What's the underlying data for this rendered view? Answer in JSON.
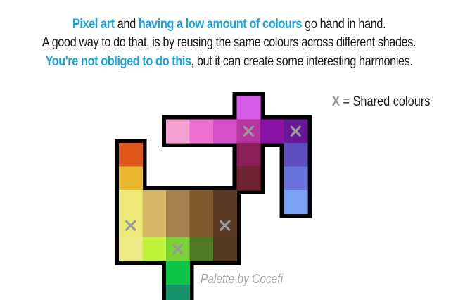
{
  "colors": {
    "accent": "#1aa3e0",
    "text": "#1a1a1a",
    "marker": "#9a9a9a",
    "credit": "#a8a8a8",
    "outline": "#000000"
  },
  "intro": {
    "line1": [
      {
        "text": "Pixel art",
        "highlight": true
      },
      {
        "text": " and ",
        "highlight": false
      },
      {
        "text": "having a low amount of colours",
        "highlight": true
      },
      {
        "text": " go hand in hand.",
        "highlight": false
      }
    ],
    "line2": [
      {
        "text": "A good way to do that, is by reusing the same colours across different shades.",
        "highlight": false
      }
    ],
    "line3": [
      {
        "text": "You're not obliged to do this",
        "highlight": true
      },
      {
        "text": ", but it can create some interesting harmonies.",
        "highlight": false
      }
    ]
  },
  "legend": {
    "marker": "X",
    "text": " = Shared colours"
  },
  "credit": "Palette by Cocefi",
  "palette": {
    "shared_marker_icon": "x-mark-icon",
    "cells": [
      {
        "col": 5,
        "row": 0,
        "color": "#d45ce6",
        "shared": false
      },
      {
        "col": 2,
        "row": 1,
        "color": "#f4a0d0",
        "shared": false
      },
      {
        "col": 3,
        "row": 1,
        "color": "#ec6fd2",
        "shared": false
      },
      {
        "col": 4,
        "row": 1,
        "color": "#d64fc8",
        "shared": false
      },
      {
        "col": 5,
        "row": 1,
        "color": "#b5359f",
        "shared": true
      },
      {
        "col": 6,
        "row": 1,
        "color": "#8a13a5",
        "shared": false
      },
      {
        "col": 7,
        "row": 1,
        "color": "#6a1796",
        "shared": true
      },
      {
        "col": 0,
        "row": 2,
        "color": "#e0561b",
        "shared": false
      },
      {
        "col": 5,
        "row": 2,
        "color": "#8b1d57",
        "shared": false
      },
      {
        "col": 7,
        "row": 2,
        "color": "#5f4fc0",
        "shared": false
      },
      {
        "col": 0,
        "row": 3,
        "color": "#e8b82e",
        "shared": false
      },
      {
        "col": 5,
        "row": 3,
        "color": "#6e2132",
        "shared": false
      },
      {
        "col": 7,
        "row": 3,
        "color": "#6a72dc",
        "shared": false
      },
      {
        "col": 0,
        "row": 4,
        "color": "#ece979",
        "shared": false
      },
      {
        "col": 1,
        "row": 4,
        "color": "#d4b766",
        "shared": false
      },
      {
        "col": 2,
        "row": 4,
        "color": "#a3804e",
        "shared": false
      },
      {
        "col": 3,
        "row": 4,
        "color": "#7f5a2c",
        "shared": false
      },
      {
        "col": 4,
        "row": 4,
        "color": "#5a3a25",
        "shared": false
      },
      {
        "col": 7,
        "row": 4,
        "color": "#7aa1f2",
        "shared": false
      },
      {
        "col": 0,
        "row": 5,
        "color": "#ece979",
        "shared": true
      },
      {
        "col": 1,
        "row": 5,
        "color": "#d4b766",
        "shared": false
      },
      {
        "col": 2,
        "row": 5,
        "color": "#a3804e",
        "shared": false
      },
      {
        "col": 3,
        "row": 5,
        "color": "#7f5a2c",
        "shared": false
      },
      {
        "col": 4,
        "row": 5,
        "color": "#5a3a25",
        "shared": true
      },
      {
        "col": 0,
        "row": 6,
        "color": "#ecea85",
        "shared": false
      },
      {
        "col": 1,
        "row": 6,
        "color": "#bff23a",
        "shared": false
      },
      {
        "col": 2,
        "row": 6,
        "color": "#7bd236",
        "shared": true
      },
      {
        "col": 3,
        "row": 6,
        "color": "#4e7a28",
        "shared": false
      },
      {
        "col": 4,
        "row": 6,
        "color": "#54391f",
        "shared": false
      },
      {
        "col": 2,
        "row": 7,
        "color": "#0dc446",
        "shared": false
      },
      {
        "col": 2,
        "row": 8,
        "color": "#149168",
        "shared": false
      }
    ]
  }
}
